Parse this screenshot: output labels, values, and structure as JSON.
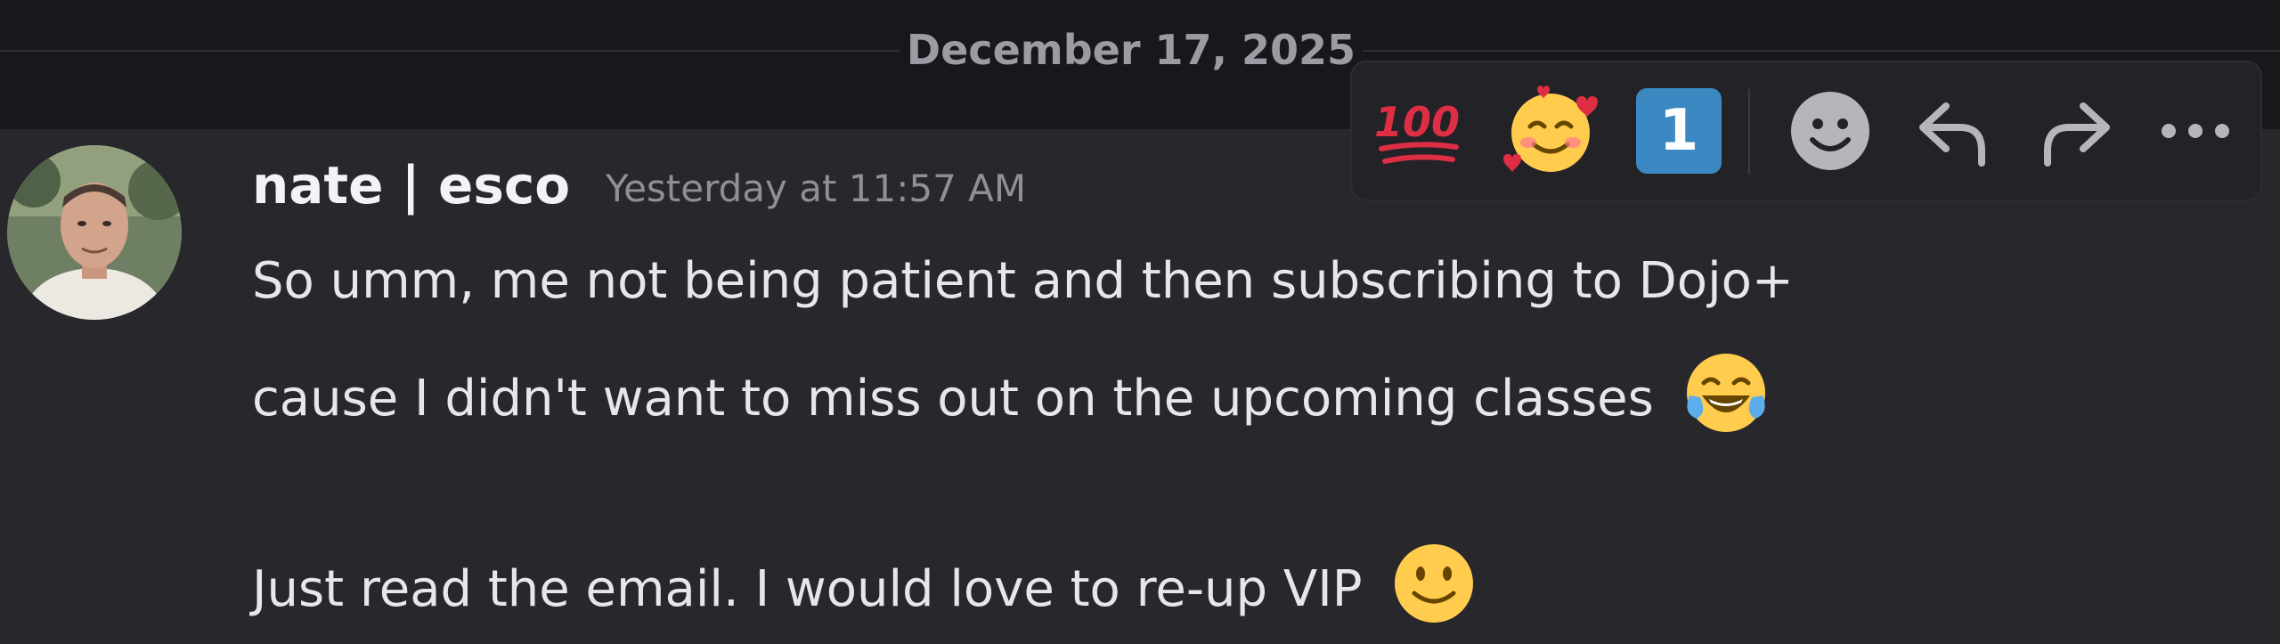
{
  "date_divider": {
    "label": "December 17, 2025"
  },
  "message": {
    "author": "nate | esco",
    "timestamp": "Yesterday at 11:57 AM",
    "line1": "So umm, me not being patient and then subscribing to Dojo+",
    "line2": "cause I didn't want to miss out on the upcoming classes",
    "line3": "Just read the email. I would love to re-up VIP"
  },
  "toolbar": {
    "quick_reactions": [
      {
        "name": "hundred-points-icon",
        "label": "100"
      },
      {
        "name": "smiling-face-with-hearts-icon"
      },
      {
        "name": "keycap-one-icon",
        "label": "1"
      }
    ],
    "actions": [
      {
        "name": "add-reaction-icon"
      },
      {
        "name": "reply-icon"
      },
      {
        "name": "forward-icon"
      },
      {
        "name": "more-options-icon"
      }
    ]
  },
  "colors": {
    "background": "#27272c",
    "username": "#f2f3f5",
    "timestamp": "#8e9097",
    "keycap_blue": "#3b88c3",
    "emoji_yellow": "#ffcc4d"
  }
}
